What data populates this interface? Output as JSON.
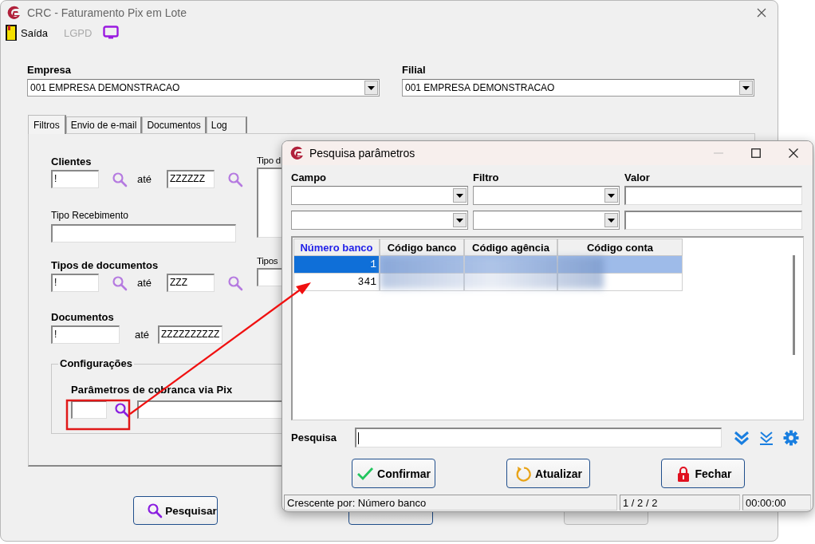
{
  "window": {
    "title": "CRC - Faturamento Pix em Lote"
  },
  "toolbar": [
    {
      "kind": "exit",
      "label": "Saída",
      "disabled": false
    },
    {
      "kind": "text",
      "label": "LGPD",
      "disabled": true
    },
    {
      "kind": "monitor"
    }
  ],
  "empresa": {
    "label": "Empresa",
    "value": "001 EMPRESA DEMONSTRACAO"
  },
  "filial": {
    "label": "Filial",
    "value": "001 EMPRESA DEMONSTRACAO"
  },
  "tabs": [
    {
      "label": "Filtros",
      "selected": true
    },
    {
      "label": "Envio de e-mail",
      "selected": false
    },
    {
      "label": "Documentos",
      "selected": false
    },
    {
      "label": "Log",
      "selected": false
    }
  ],
  "filters": [
    {
      "kind": "range-lookup",
      "label": "Clientes",
      "from": "!",
      "joiner": "até",
      "to": "ZZZZZZ"
    },
    {
      "kind": "text",
      "label": "Tipo Recebimento"
    },
    {
      "kind": "range-lookup",
      "label": "Tipos de documentos",
      "from": "!",
      "joiner": "até",
      "to": "ZZZ"
    },
    {
      "kind": "range",
      "label": "Documentos",
      "from": "!",
      "joiner": "até",
      "to": "ZZZZZZZZZZ"
    }
  ],
  "side_filters": [
    {
      "kind": "list",
      "label": "Tipo d"
    },
    {
      "kind": "field",
      "label": "Tipos"
    }
  ],
  "configuracoes": {
    "title": "Configurações",
    "field_label": "Parâmetros de cobranca via Pix"
  },
  "bottom_buttons": [
    {
      "kind": "search",
      "label": "Pesquisar",
      "disabled": false
    },
    {
      "kind": "clear",
      "disabled": false
    },
    {
      "kind": "process",
      "disabled": true
    }
  ],
  "dialog": {
    "title": "Pesquisa parâmetros",
    "filter_headers": [
      "Campo",
      "Filtro",
      "Valor"
    ],
    "grid": {
      "columns": [
        {
          "label": "Número banco",
          "selected": true
        },
        {
          "label": "Código banco",
          "selected": false
        },
        {
          "label": "Código agência",
          "selected": false
        },
        {
          "label": "Código conta",
          "selected": false
        }
      ],
      "rows": [
        {
          "number": "1",
          "selected": true
        },
        {
          "number": "341",
          "selected": false
        }
      ]
    },
    "search": {
      "label": "Pesquisa"
    },
    "buttons": [
      {
        "kind": "confirm",
        "label": "Confirmar"
      },
      {
        "kind": "refresh",
        "label": "Atualizar"
      },
      {
        "kind": "close",
        "label": "Fechar"
      }
    ],
    "status_bar": [
      "Crescente por: Número banco",
      "1 / 2 / 2",
      "00:00:00"
    ]
  }
}
